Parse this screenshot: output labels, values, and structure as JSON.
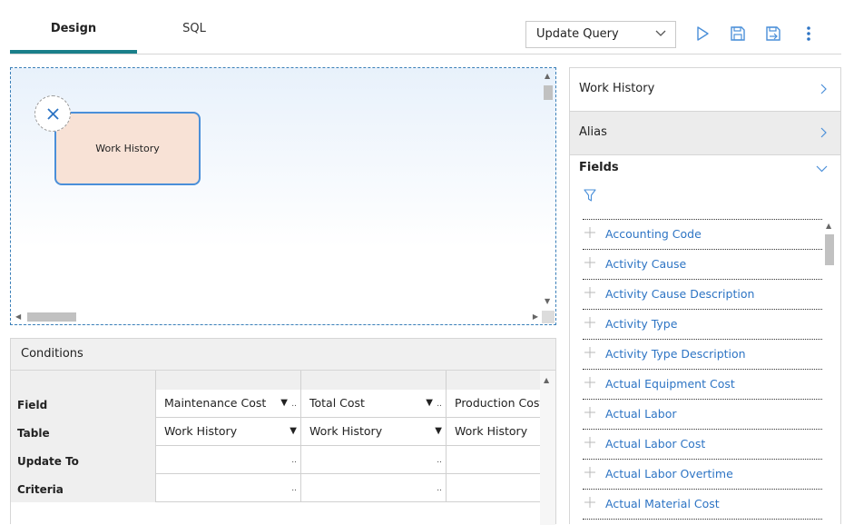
{
  "tabs": [
    {
      "label": "Design",
      "active": true
    },
    {
      "label": "SQL",
      "active": false
    }
  ],
  "toolbar": {
    "query_type": "Update Query",
    "icons": [
      "run-icon",
      "save-icon",
      "save-as-icon",
      "more-icon"
    ]
  },
  "canvas": {
    "node_label": "Work History"
  },
  "conditions": {
    "title": "Conditions",
    "row_labels": [
      "Field",
      "Table",
      "Update To",
      "Criteria"
    ],
    "columns": [
      {
        "field": "Maintenance Cost",
        "table": "Work History"
      },
      {
        "field": "Total Cost",
        "table": "Work History"
      },
      {
        "field": "Production Cost",
        "table": "Work History"
      }
    ],
    "dropdown_glyph": "▼",
    "ellipsis_glyph": ".."
  },
  "right_panel": {
    "source": "Work History",
    "alias": "Alias",
    "fields_title": "Fields",
    "fields": [
      "Accounting Code",
      "Activity Cause",
      "Activity Cause Description",
      "Activity Type",
      "Activity Type Description",
      "Actual Equipment Cost",
      "Actual Labor",
      "Actual Labor Cost",
      "Actual Labor Overtime",
      "Actual Material Cost"
    ]
  },
  "colors": {
    "accent": "#1a7f8a",
    "link": "#2d74c4",
    "node_fill": "#f8e2d6",
    "node_border": "#4a8fd9"
  }
}
